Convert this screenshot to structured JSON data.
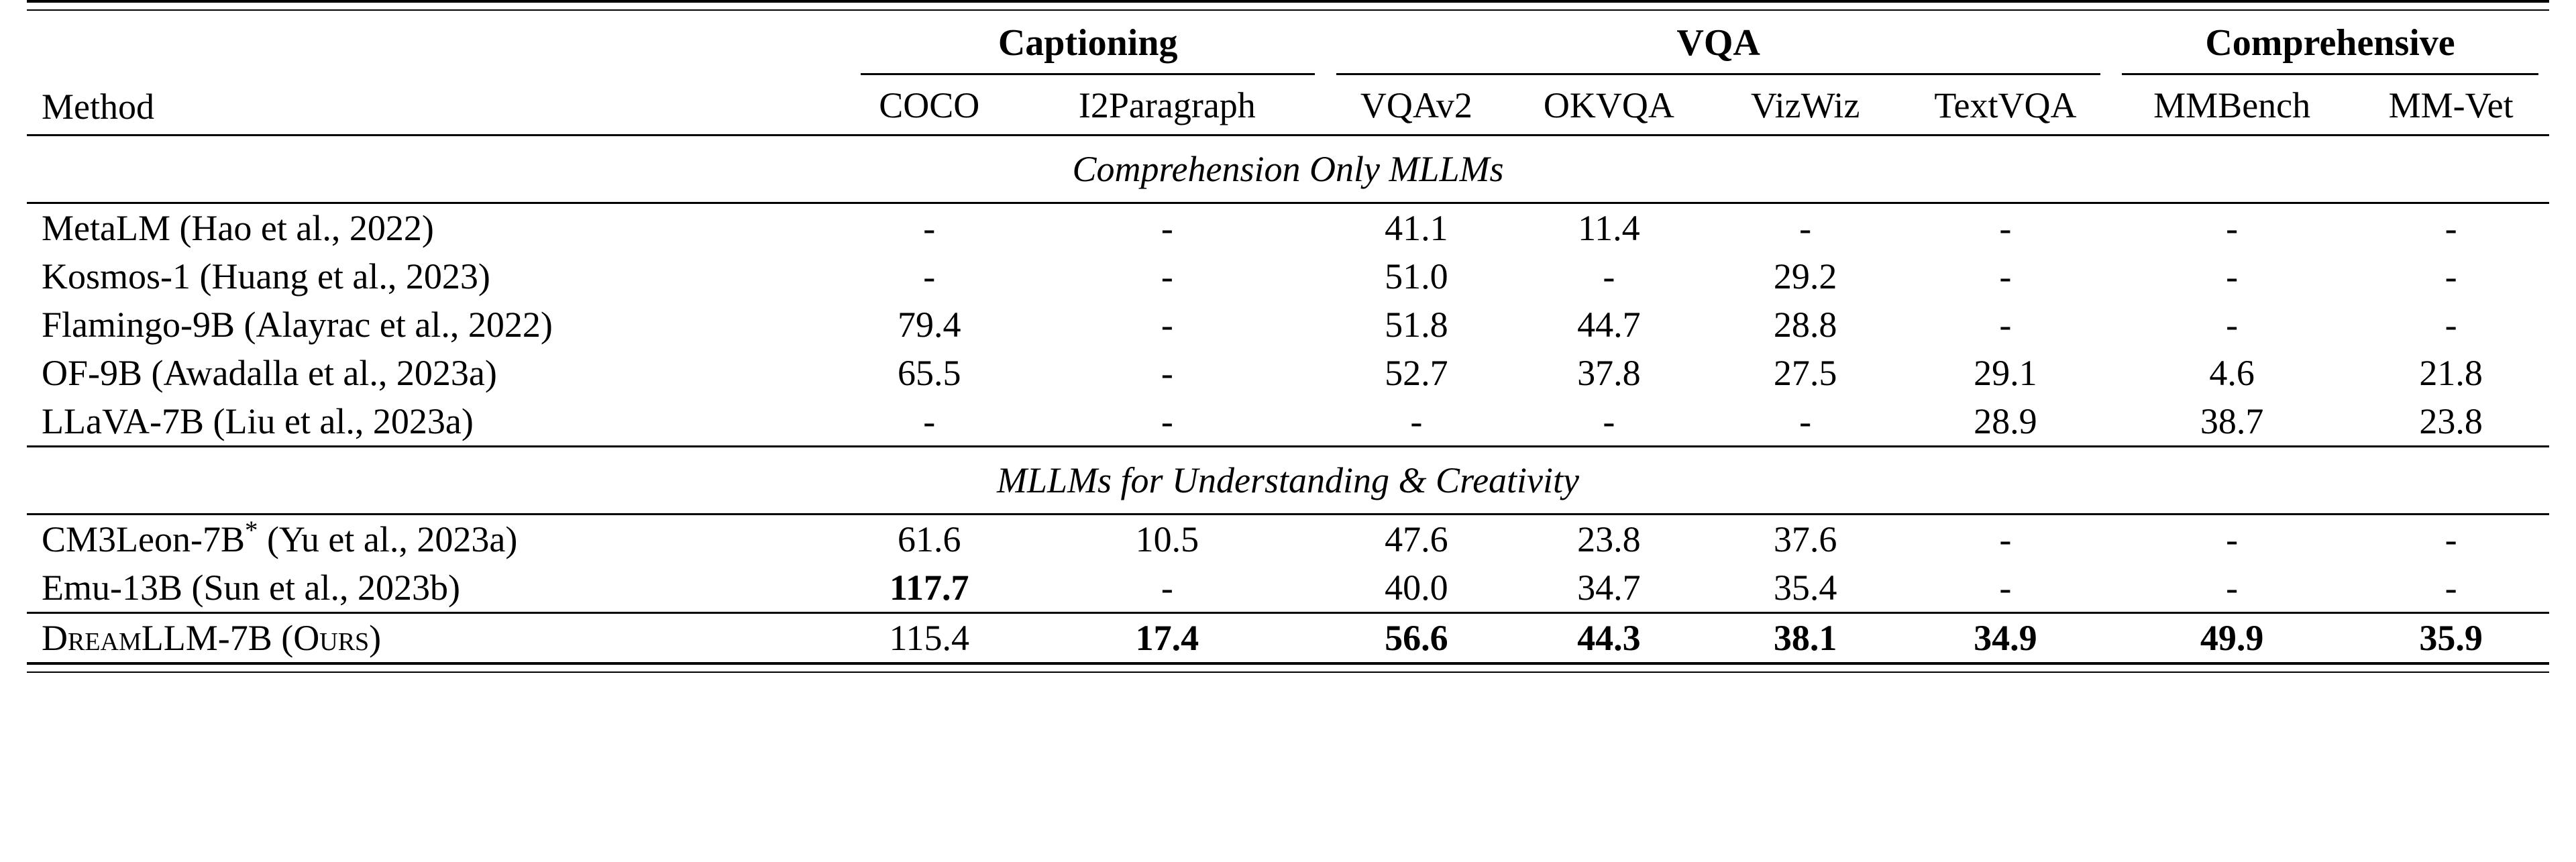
{
  "table": {
    "method_header": "Method",
    "groups": [
      {
        "label": "Captioning",
        "span": 2
      },
      {
        "label": "VQA",
        "span": 4
      },
      {
        "label": "Comprehensive",
        "span": 2
      }
    ],
    "columns": [
      "COCO",
      "I2Paragraph",
      "VQAv2",
      "OKVQA",
      "VizWiz",
      "TextVQA",
      "MMBench",
      "MM-Vet"
    ],
    "sections": [
      {
        "banner": "Comprehension Only MLLMs",
        "rows": [
          {
            "method": "MetaLM (Hao et al., 2022)",
            "method_star": false,
            "smallcaps": false,
            "values": [
              "-",
              "-",
              "41.1",
              "11.4",
              "-",
              "-",
              "-",
              "-"
            ],
            "bold": [
              false,
              false,
              false,
              false,
              false,
              false,
              false,
              false
            ]
          },
          {
            "method": "Kosmos-1 (Huang et al., 2023)",
            "method_star": false,
            "smallcaps": false,
            "values": [
              "-",
              "-",
              "51.0",
              "-",
              "29.2",
              "-",
              "-",
              "-"
            ],
            "bold": [
              false,
              false,
              false,
              false,
              false,
              false,
              false,
              false
            ]
          },
          {
            "method": "Flamingo-9B (Alayrac et al., 2022)",
            "method_star": false,
            "smallcaps": false,
            "values": [
              "79.4",
              "-",
              "51.8",
              "44.7",
              "28.8",
              "-",
              "-",
              "-"
            ],
            "bold": [
              false,
              false,
              false,
              false,
              false,
              false,
              false,
              false
            ]
          },
          {
            "method": "OF-9B (Awadalla et al., 2023a)",
            "method_star": false,
            "smallcaps": false,
            "values": [
              "65.5",
              "-",
              "52.7",
              "37.8",
              "27.5",
              "29.1",
              "4.6",
              "21.8"
            ],
            "bold": [
              false,
              false,
              false,
              false,
              false,
              false,
              false,
              false
            ]
          },
          {
            "method": "LLaVA-7B (Liu et al., 2023a)",
            "method_star": false,
            "smallcaps": false,
            "values": [
              "-",
              "-",
              "-",
              "-",
              "-",
              "28.9",
              "38.7",
              "23.8"
            ],
            "bold": [
              false,
              false,
              false,
              false,
              false,
              false,
              false,
              false
            ]
          }
        ]
      },
      {
        "banner": "MLLMs for Understanding & Creativity",
        "rows": [
          {
            "method": "CM3Leon-7B",
            "method_suffix": " (Yu et al., 2023a)",
            "method_star": true,
            "smallcaps": false,
            "values": [
              "61.6",
              "10.5",
              "47.6",
              "23.8",
              "37.6",
              "-",
              "-",
              "-"
            ],
            "bold": [
              false,
              false,
              false,
              false,
              false,
              false,
              false,
              false
            ]
          },
          {
            "method": "Emu-13B (Sun et al., 2023b)",
            "method_star": false,
            "smallcaps": false,
            "values": [
              "117.7",
              "-",
              "40.0",
              "34.7",
              "35.4",
              "-",
              "-",
              "-"
            ],
            "bold": [
              true,
              false,
              false,
              false,
              false,
              false,
              false,
              false
            ]
          }
        ]
      },
      {
        "banner": null,
        "rows": [
          {
            "method": "DreamLLM-7B (Ours)",
            "method_star": false,
            "smallcaps": true,
            "values": [
              "115.4",
              "17.4",
              "56.6",
              "44.3",
              "38.1",
              "34.9",
              "49.9",
              "35.9"
            ],
            "bold": [
              false,
              true,
              true,
              true,
              true,
              true,
              true,
              true
            ]
          }
        ]
      }
    ]
  }
}
